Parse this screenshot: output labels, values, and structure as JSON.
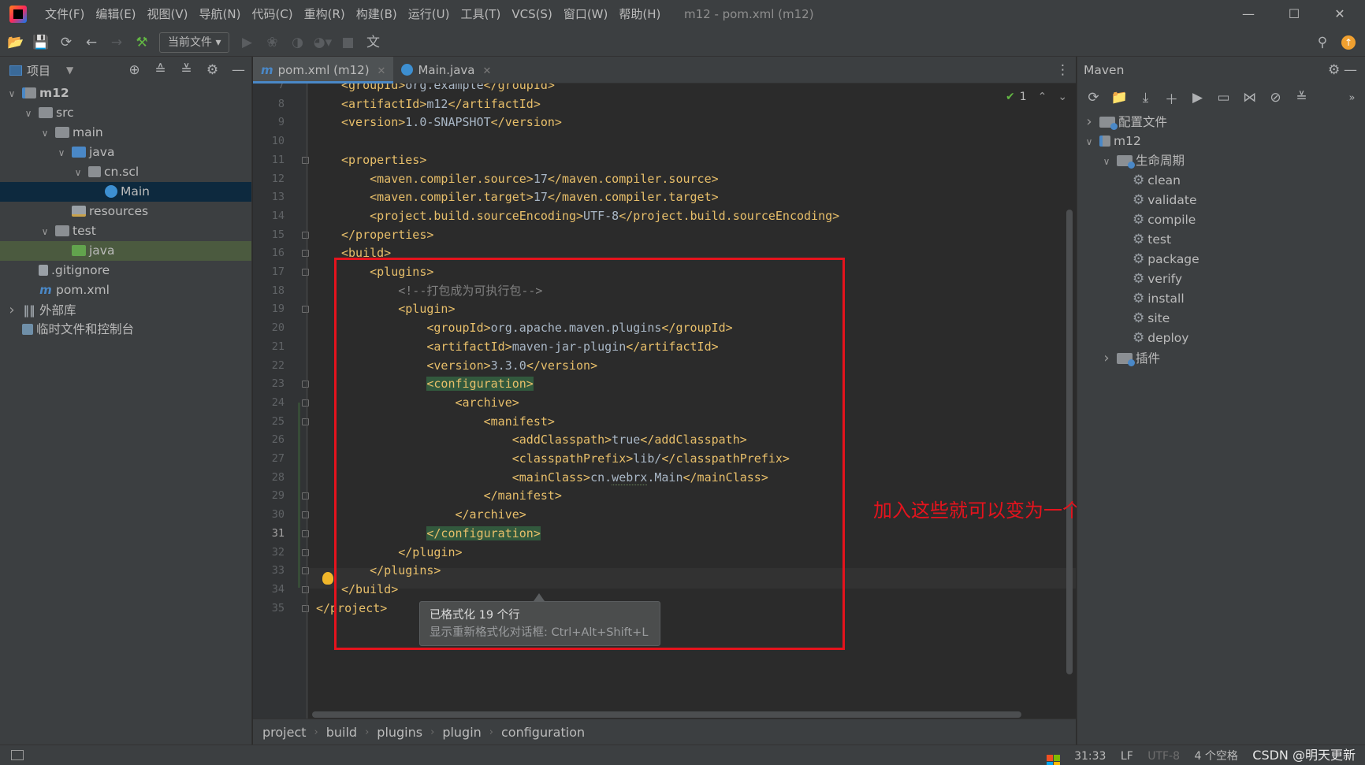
{
  "window": {
    "title": "m12 - pom.xml (m12)",
    "menus": [
      "文件(F)",
      "编辑(E)",
      "视图(V)",
      "导航(N)",
      "代码(C)",
      "重构(R)",
      "构建(B)",
      "运行(U)",
      "工具(T)",
      "VCS(S)",
      "窗口(W)",
      "帮助(H)"
    ]
  },
  "toolbar": {
    "run_config": "当前文件"
  },
  "project": {
    "title": "项目",
    "tree": [
      {
        "label": "m12",
        "depth": 0,
        "icon": "module-folder-icon",
        "twisty": "open"
      },
      {
        "label": "src",
        "depth": 1,
        "icon": "folder-icon",
        "twisty": "open"
      },
      {
        "label": "main",
        "depth": 2,
        "icon": "folder-icon",
        "twisty": "open"
      },
      {
        "label": "java",
        "depth": 3,
        "icon": "source-folder-icon",
        "twisty": "open"
      },
      {
        "label": "cn.scl",
        "depth": 4,
        "icon": "package-icon",
        "twisty": "open"
      },
      {
        "label": "Main",
        "depth": 5,
        "icon": "java-class-icon",
        "twisty": "none",
        "state": "selected"
      },
      {
        "label": "resources",
        "depth": 3,
        "icon": "resources-folder-icon",
        "twisty": "none"
      },
      {
        "label": "test",
        "depth": 2,
        "icon": "folder-icon",
        "twisty": "open"
      },
      {
        "label": "java",
        "depth": 3,
        "icon": "test-folder-icon",
        "twisty": "none",
        "state": "highlighted"
      },
      {
        "label": ".gitignore",
        "depth": 1,
        "icon": "gitignore-file-icon",
        "twisty": "none"
      },
      {
        "label": "pom.xml",
        "depth": 1,
        "icon": "maven-file-icon",
        "twisty": "none"
      },
      {
        "label": "外部库",
        "depth": 0,
        "icon": "library-icon",
        "twisty": "closed"
      },
      {
        "label": "临时文件和控制台",
        "depth": 0,
        "icon": "scratches-icon",
        "twisty": "none"
      }
    ]
  },
  "tabs": [
    {
      "label": "pom.xml (m12)",
      "active": true,
      "icon": "m"
    },
    {
      "label": "Main.java",
      "active": false,
      "icon": "c"
    }
  ],
  "editor": {
    "current_line": 31,
    "inspection_count": "1",
    "lines": [
      {
        "n": "7",
        "code": "    <groupId>org.example</groupId>"
      },
      {
        "n": "8",
        "code": "    <artifactId>m12</artifactId>"
      },
      {
        "n": "9",
        "code": "    <version>1.0-SNAPSHOT</version>"
      },
      {
        "n": "10",
        "code": ""
      },
      {
        "n": "11",
        "code": "    <properties>"
      },
      {
        "n": "12",
        "code": "        <maven.compiler.source>17</maven.compiler.source>"
      },
      {
        "n": "13",
        "code": "        <maven.compiler.target>17</maven.compiler.target>"
      },
      {
        "n": "14",
        "code": "        <project.build.sourceEncoding>UTF-8</project.build.sourceEncoding>"
      },
      {
        "n": "15",
        "code": "    </properties>"
      },
      {
        "n": "16",
        "code": "    <build>"
      },
      {
        "n": "17",
        "code": "        <plugins>"
      },
      {
        "n": "18",
        "code": "            <!--打包成为可执行包-->"
      },
      {
        "n": "19",
        "code": "            <plugin>"
      },
      {
        "n": "20",
        "code": "                <groupId>org.apache.maven.plugins</groupId>"
      },
      {
        "n": "21",
        "code": "                <artifactId>maven-jar-plugin</artifactId>"
      },
      {
        "n": "22",
        "code": "                <version>3.3.0</version>"
      },
      {
        "n": "23",
        "code": "                <configuration>"
      },
      {
        "n": "24",
        "code": "                    <archive>"
      },
      {
        "n": "25",
        "code": "                        <manifest>"
      },
      {
        "n": "26",
        "code": "                            <addClasspath>true</addClasspath>"
      },
      {
        "n": "27",
        "code": "                            <classpathPrefix>lib/</classpathPrefix>"
      },
      {
        "n": "28",
        "code": "                            <mainClass>cn.webrx.Main</mainClass>"
      },
      {
        "n": "29",
        "code": "                        </manifest>"
      },
      {
        "n": "30",
        "code": "                    </archive>"
      },
      {
        "n": "31",
        "code": "                </configuration>"
      },
      {
        "n": "32",
        "code": "            </plugin>"
      },
      {
        "n": "33",
        "code": "        </plugins>"
      },
      {
        "n": "34",
        "code": "    </build>"
      },
      {
        "n": "35",
        "code": "</project>"
      }
    ],
    "tooltip": {
      "title": "已格式化 19 个行",
      "hint": "显示重新格式化对话框: Ctrl+Alt+Shift+L"
    },
    "annotation": "加入这些就可以变为一个可执行包",
    "annotation_color": "#e5131d"
  },
  "breadcrumb": [
    "project",
    "build",
    "plugins",
    "plugin",
    "configuration"
  ],
  "maven": {
    "title": "Maven",
    "tree": [
      {
        "label": "配置文件",
        "depth": 0,
        "twisty": "closed",
        "icon": "profiles-icon"
      },
      {
        "label": "m12",
        "depth": 0,
        "twisty": "open",
        "icon": "maven-module-icon"
      },
      {
        "label": "生命周期",
        "depth": 1,
        "twisty": "open",
        "icon": "lifecycle-folder-icon"
      },
      {
        "label": "clean",
        "depth": 2,
        "twisty": "none",
        "icon": "gear-icon"
      },
      {
        "label": "validate",
        "depth": 2,
        "twisty": "none",
        "icon": "gear-icon"
      },
      {
        "label": "compile",
        "depth": 2,
        "twisty": "none",
        "icon": "gear-icon"
      },
      {
        "label": "test",
        "depth": 2,
        "twisty": "none",
        "icon": "gear-icon"
      },
      {
        "label": "package",
        "depth": 2,
        "twisty": "none",
        "icon": "gear-icon"
      },
      {
        "label": "verify",
        "depth": 2,
        "twisty": "none",
        "icon": "gear-icon"
      },
      {
        "label": "install",
        "depth": 2,
        "twisty": "none",
        "icon": "gear-icon"
      },
      {
        "label": "site",
        "depth": 2,
        "twisty": "none",
        "icon": "gear-icon"
      },
      {
        "label": "deploy",
        "depth": 2,
        "twisty": "none",
        "icon": "gear-icon"
      },
      {
        "label": "插件",
        "depth": 1,
        "twisty": "closed",
        "icon": "plugins-folder-icon"
      }
    ]
  },
  "status": {
    "position": "31:33",
    "line_sep": "LF",
    "encoding": "UTF-8",
    "indent": "4 个空格",
    "watermark": "CSDN @明天更新"
  },
  "colors": {
    "accent": "#4a88c7",
    "tag": "#e8bf6a",
    "text": "#a9b7c6",
    "comment": "#808080"
  }
}
